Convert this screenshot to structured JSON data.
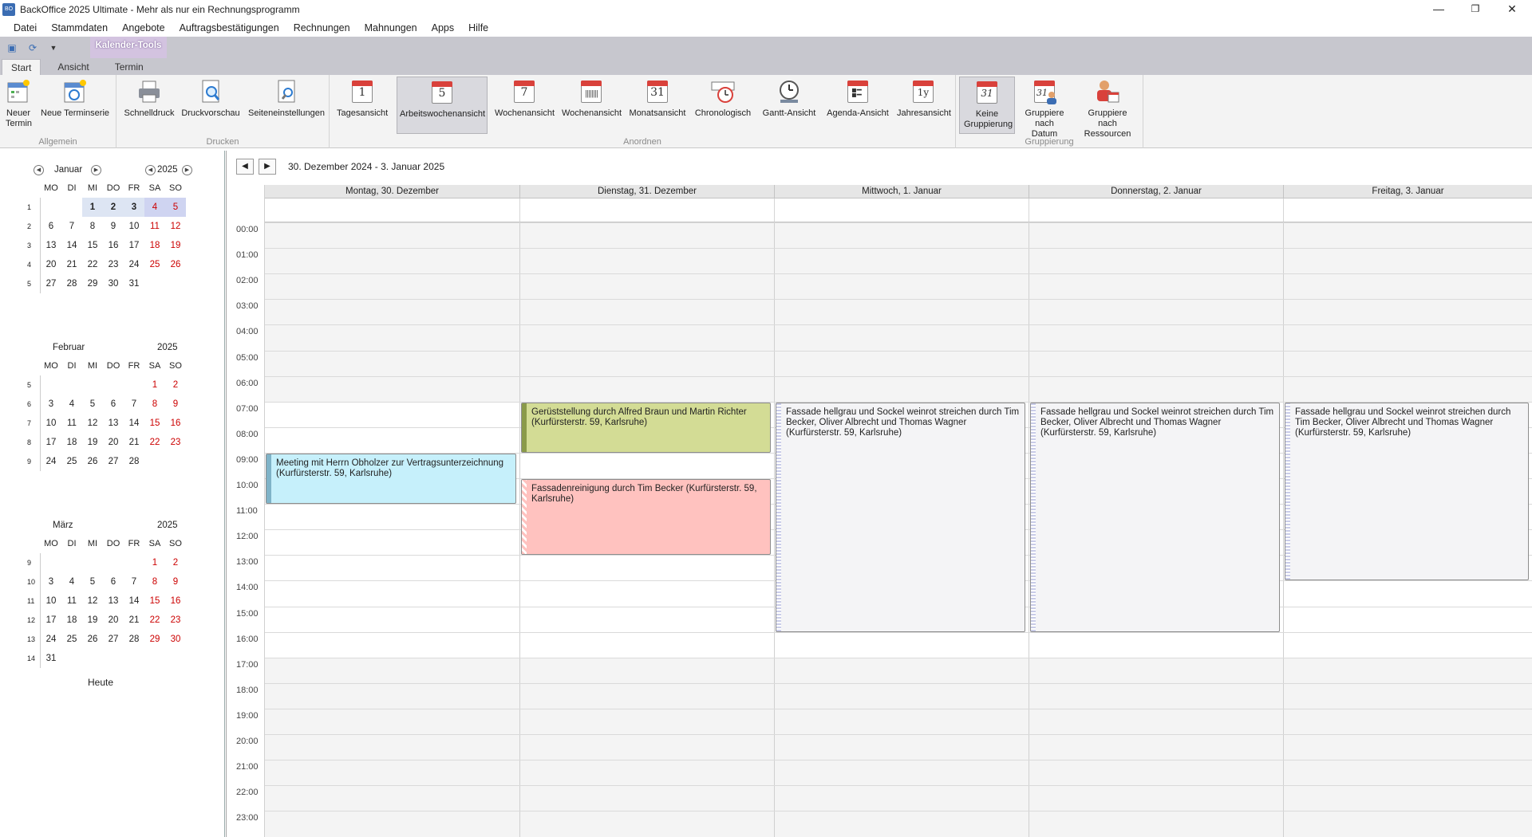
{
  "window": {
    "title": "BackOffice 2025 Ultimate - Mehr als nur ein Rechnungsprogramm",
    "app_icon": "BO"
  },
  "menu": [
    "Datei",
    "Stammdaten",
    "Angebote",
    "Auftragsbestätigungen",
    "Rechnungen",
    "Mahnungen",
    "Apps",
    "Hilfe"
  ],
  "context_tab": "Kalender-Tools",
  "tabs": [
    "Start",
    "Ansicht",
    "Termin"
  ],
  "ribbon": {
    "groups": [
      "Allgemein",
      "Drucken",
      "Anordnen",
      "Gruppierung"
    ],
    "allgemein": {
      "new_appointment": "Neuer Termin",
      "new_series": "Neue Terminserie"
    },
    "drucken": {
      "quick_print": "Schnelldruck",
      "print_preview": "Druckvorschau",
      "page_setup": "Seiteneinstellungen"
    },
    "anordnen": {
      "day": "Tagesansicht",
      "workweek": "Arbeitswochenansicht",
      "week": "Wochenansicht",
      "fullweek": "Wochenansicht",
      "month": "Monatsansicht",
      "timeline": "Chronologisch",
      "gantt": "Gantt-Ansicht",
      "agenda": "Agenda-Ansicht",
      "year": "Jahresansicht"
    },
    "gruppierung": {
      "none": "Keine Gruppierung",
      "by_date": "Gruppiere nach Datum",
      "by_resource": "Gruppiere nach Ressourcen"
    },
    "icon_numbers": {
      "day": "1",
      "workweek": "5",
      "week": "7",
      "month": "31",
      "year": "1y",
      "none": "31",
      "by_date": "31"
    }
  },
  "minicalendar": {
    "weekdays": [
      "MO",
      "DI",
      "MI",
      "DO",
      "FR",
      "SA",
      "SO"
    ],
    "today_label": "Heute",
    "months": [
      {
        "name": "Januar",
        "year": "2025",
        "weeks": [
          {
            "wk": "1",
            "days": [
              "",
              "",
              "1",
              "2",
              "3",
              "4",
              "5"
            ]
          },
          {
            "wk": "2",
            "days": [
              "6",
              "7",
              "8",
              "9",
              "10",
              "11",
              "12"
            ]
          },
          {
            "wk": "3",
            "days": [
              "13",
              "14",
              "15",
              "16",
              "17",
              "18",
              "19"
            ]
          },
          {
            "wk": "4",
            "days": [
              "20",
              "21",
              "22",
              "23",
              "24",
              "25",
              "26"
            ]
          },
          {
            "wk": "5",
            "days": [
              "27",
              "28",
              "29",
              "30",
              "31",
              "",
              ""
            ]
          }
        ]
      },
      {
        "name": "Februar",
        "year": "2025",
        "weeks": [
          {
            "wk": "5",
            "days": [
              "",
              "",
              "",
              "",
              "",
              "1",
              "2"
            ]
          },
          {
            "wk": "6",
            "days": [
              "3",
              "4",
              "5",
              "6",
              "7",
              "8",
              "9"
            ]
          },
          {
            "wk": "7",
            "days": [
              "10",
              "11",
              "12",
              "13",
              "14",
              "15",
              "16"
            ]
          },
          {
            "wk": "8",
            "days": [
              "17",
              "18",
              "19",
              "20",
              "21",
              "22",
              "23"
            ]
          },
          {
            "wk": "9",
            "days": [
              "24",
              "25",
              "26",
              "27",
              "28",
              "",
              ""
            ]
          }
        ]
      },
      {
        "name": "März",
        "year": "2025",
        "weeks": [
          {
            "wk": "9",
            "days": [
              "",
              "",
              "",
              "",
              "",
              "1",
              "2"
            ]
          },
          {
            "wk": "10",
            "days": [
              "3",
              "4",
              "5",
              "6",
              "7",
              "8",
              "9"
            ]
          },
          {
            "wk": "11",
            "days": [
              "10",
              "11",
              "12",
              "13",
              "14",
              "15",
              "16"
            ]
          },
          {
            "wk": "12",
            "days": [
              "17",
              "18",
              "19",
              "20",
              "21",
              "22",
              "23"
            ]
          },
          {
            "wk": "13",
            "days": [
              "24",
              "25",
              "26",
              "27",
              "28",
              "29",
              "30"
            ]
          },
          {
            "wk": "14",
            "days": [
              "31",
              "",
              "",
              "",
              "",
              "",
              ""
            ]
          }
        ]
      }
    ]
  },
  "scheduler": {
    "range": "30. Dezember 2024 - 3. Januar 2025",
    "days": [
      "Montag, 30. Dezember",
      "Dienstag, 31. Dezember",
      "Mittwoch, 1. Januar",
      "Donnerstag, 2. Januar",
      "Freitag, 3. Januar"
    ],
    "hours": [
      "00:00",
      "01:00",
      "02:00",
      "03:00",
      "04:00",
      "05:00",
      "06:00",
      "07:00",
      "08:00",
      "09:00",
      "10:00",
      "11:00",
      "12:00",
      "13:00",
      "14:00",
      "15:00",
      "16:00",
      "17:00",
      "18:00",
      "19:00",
      "20:00",
      "21:00",
      "22:00",
      "23:00"
    ],
    "appointments": [
      {
        "day": 0,
        "start": 9,
        "end": 11,
        "text": "Meeting mit Herrn Obholzer zur Vertragsunterzeichnung (Kurfürsterstr. 59, Karlsruhe)",
        "color": "#c6f0fb",
        "status": "#7fb3c8"
      },
      {
        "day": 1,
        "start": 7,
        "end": 9,
        "text": "Gerüststellung durch Alfred Braun und Martin Richter (Kurfürsterstr. 59, Karlsruhe)",
        "color": "#d3dc95",
        "status": "#8a9a4a"
      },
      {
        "day": 1,
        "start": 10,
        "end": 13,
        "text": "Fassadenreinigung durch Tim Becker (Kurfürsterstr. 59, Karlsruhe)",
        "color": "#ffc2bf",
        "status": "hatched"
      },
      {
        "day": 2,
        "start": 7,
        "end": 16,
        "text": "Fassade hellgrau und Sockel weinrot streichen durch Tim Becker, Oliver Albrecht und Thomas Wagner (Kurfürsterstr. 59, Karlsruhe)",
        "color": "#f4f4f6",
        "status": "dotted"
      },
      {
        "day": 3,
        "start": 7,
        "end": 16,
        "text": "Fassade hellgrau und Sockel weinrot streichen durch Tim Becker, Oliver Albrecht und Thomas Wagner (Kurfürsterstr. 59, Karlsruhe)",
        "color": "#f4f4f6",
        "status": "dotted"
      },
      {
        "day": 4,
        "start": 7,
        "end": 14,
        "text": "Fassade hellgrau und Sockel weinrot streichen durch Tim Becker, Oliver Albrecht und Thomas Wagner (Kurfürsterstr. 59, Karlsruhe)",
        "color": "#f4f4f6",
        "status": "dotted"
      }
    ]
  }
}
